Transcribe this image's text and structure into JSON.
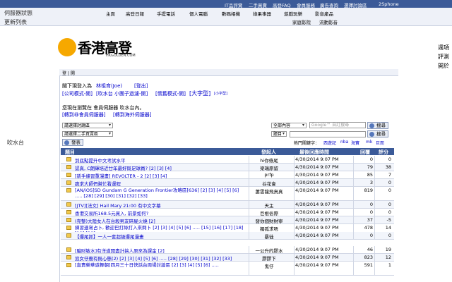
{
  "top_links": [
    "IT品評賞",
    "二手買賣",
    "高登FAQ",
    "會員服務",
    "廣告查詢",
    "選擇討論區",
    "2Sphone"
  ],
  "nav": [
    "主頁",
    "高登日報",
    "手提電話",
    "個人電腦",
    "數碼相機",
    "綠果事器",
    "遊戲玩樂",
    "影音產品"
  ],
  "subnav": [
    "家庭影院",
    "流動影音"
  ],
  "left": {
    "status": "伺服器狀態",
    "update": "更新列表",
    "chat": "吹水台"
  },
  "right_links": [
    "週項",
    "評測",
    "開於"
  ],
  "logo": {
    "cn": "香港高登",
    "en": "HKGOLDEN.COM"
  },
  "panel_head": "登 | 開",
  "user": {
    "line1_prefix": "閣下現登入為",
    "user_name": "林祖育(Joe)",
    "logout": "[登出]",
    "mode_links": [
      "[公司模式-開]",
      "[吹水台 小團子過濾-開]",
      "[懷舊模式-開]",
      "[大字型]"
    ],
    "small_font": "[小字型]"
  },
  "server": {
    "line": "您現在瀏覽在 會員伺服器 吹水台內。",
    "links": [
      "[轉到非會員伺服器]",
      "[轉到海外伺服器]"
    ]
  },
  "controls": {
    "forum_select": "請選擇討論區",
    "sale_select": "請選擇二手買賣區",
    "content_select": "全部內容",
    "title_select": "題目",
    "search_placeholder": "Google™ 自訂搜尋",
    "search_button": "搜尋",
    "search_button2": "搜尋",
    "new_post_button": "發表",
    "hot_keywords_label": "熱門關鍵字：",
    "hot_keywords": [
      "西遊記",
      "nba",
      "海寶",
      "mk",
      "巨而"
    ]
  },
  "table": {
    "headers": {
      "title": "題目",
      "author": "發起人",
      "time": "最後回應時間",
      "replies": "回覆",
      "score": "評分"
    },
    "rows": [
      {
        "title": "到底點提升中文考試水平",
        "author": "hi你條尾",
        "time": "4/30/2014  9:07 PM",
        "replies": "0",
        "score": "0"
      },
      {
        "title": "認真, C朗輝培近廿年最好既足球員? [2] [3] [4]",
        "author": "梁瑞原留",
        "time": "4/30/2014  9:07 PM",
        "replies": "79",
        "score": "38"
      },
      {
        "title": "[新手練習重漫畫] REVOLTER - 2 [2] [3] [4]",
        "author": "prfp",
        "time": "4/30/2014  9:07 PM",
        "replies": "85",
        "score": "7"
      },
      {
        "title": "跪求大師們幫忙看運程",
        "author": "谷花會",
        "time": "4/30/2014  9:07 PM",
        "replies": "3",
        "score": "0"
      },
      {
        "title": "[AN/iOS]SD Gundam G Generation Frontier攻略區[636] [2] [3] [4] [5] [6] ..... [28] [29] [30] [31] [32] [33]",
        "author": "蕭雲龍飛鳥真",
        "time": "4/30/2014  9:07 PM",
        "replies": "819",
        "score": "0"
      },
      {
        "title": "[JTV][法文] Hail Mary 21:00 有中文字幕",
        "author": "天主",
        "time": "4/30/2014  9:07 PM",
        "replies": "0",
        "score": "0"
      },
      {
        "title": "香港交易所168.5元買入, 前景如何?",
        "author": "巨根俗際",
        "time": "4/30/2014  9:07 PM",
        "replies": "0",
        "score": "0"
      },
      {
        "title": "(完整)大陸女人在台殺男友碎屍火燒 [2]",
        "author": "發你個財財寧",
        "time": "4/30/2014  9:07 PM",
        "replies": "37",
        "score": "-5"
      },
      {
        "title": "練習速寫占卜, 歡迎巴打絲打入來問卜 [2] [3] [4] [5] [6] ..... [15] [16] [17] [18] [19] [20]",
        "author": "獨孤求唔",
        "time": "4/30/2014  9:07 PM",
        "replies": "478",
        "score": "14"
      },
      {
        "title": "【爆尾抓】一人一套超級爆尾漫畫",
        "author": "暴徒",
        "time": "4/30/2014  9:07 PM",
        "replies": "0",
        "score": "0"
      },
      {
        "title": "[騙財敏水]有洋道開盡計搞人原來為課金 [2]",
        "author": "一公升的膠水",
        "time": "4/30/2014  9:07 PM",
        "replies": "46",
        "score": "19"
      },
      {
        "title": "追女仔應有既心態(2) [2] [3] [4] [5] [6] ..... [28] [29] [30] [31] [32] [33]",
        "author": "膠膠下",
        "time": "4/30/2014  9:07 PM",
        "replies": "823",
        "score": "12"
      },
      {
        "title": "[直賣榮華遊舞朝]四月三十日快話台周場討論區 [2] [3] [4] [5] [6] .....",
        "author": "鬼仔",
        "time": "4/30/2014  9:07 PM",
        "replies": "591",
        "score": "1"
      }
    ]
  }
}
